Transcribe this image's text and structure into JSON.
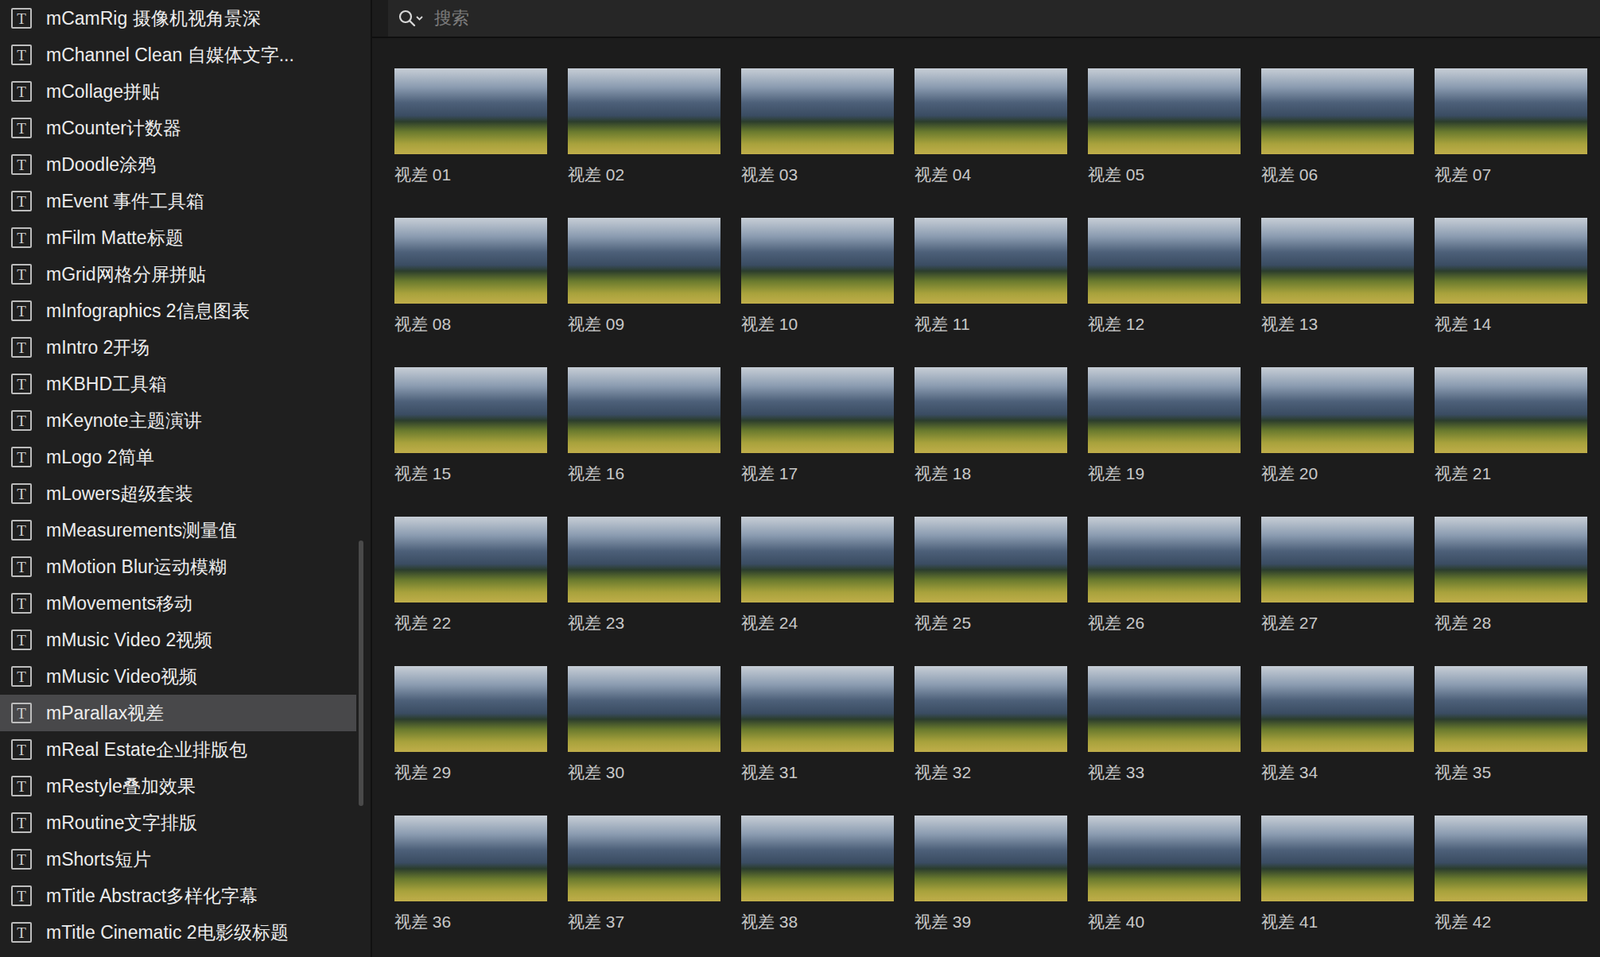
{
  "sidebar": {
    "item_icon": "T",
    "items": [
      {
        "label": "mCamRig 摄像机视角景深",
        "selected": false
      },
      {
        "label": "mChannel Clean 自媒体文字...",
        "selected": false
      },
      {
        "label": "mCollage拼贴",
        "selected": false
      },
      {
        "label": "mCounter计数器",
        "selected": false
      },
      {
        "label": "mDoodle涂鸦",
        "selected": false
      },
      {
        "label": "mEvent 事件工具箱",
        "selected": false
      },
      {
        "label": "mFilm Matte标题",
        "selected": false
      },
      {
        "label": "mGrid网格分屏拼贴",
        "selected": false
      },
      {
        "label": "mInfographics 2信息图表",
        "selected": false
      },
      {
        "label": "mIntro 2开场",
        "selected": false
      },
      {
        "label": "mKBHD工具箱",
        "selected": false
      },
      {
        "label": "mKeynote主题演讲",
        "selected": false
      },
      {
        "label": "mLogo 2简单",
        "selected": false
      },
      {
        "label": "mLowers超级套装",
        "selected": false
      },
      {
        "label": "mMeasurements测量值",
        "selected": false
      },
      {
        "label": "mMotion Blur运动模糊",
        "selected": false
      },
      {
        "label": "mMovements移动",
        "selected": false
      },
      {
        "label": "mMusic Video 2视频",
        "selected": false
      },
      {
        "label": "mMusic Video视频",
        "selected": false
      },
      {
        "label": "mParallax视差",
        "selected": true
      },
      {
        "label": "mReal Estate企业排版包",
        "selected": false
      },
      {
        "label": "mRestyle叠加效果",
        "selected": false
      },
      {
        "label": "mRoutine文字排版",
        "selected": false
      },
      {
        "label": "mShorts短片",
        "selected": false
      },
      {
        "label": "mTitle Abstract多样化字幕",
        "selected": false
      },
      {
        "label": "mTitle Cinematic 2电影级标题",
        "selected": false
      }
    ]
  },
  "scrollbar": {
    "position": 0.565,
    "size": 0.277
  },
  "search": {
    "placeholder": "搜索"
  },
  "thumbnails": [
    {
      "label": "视差 01"
    },
    {
      "label": "视差 02"
    },
    {
      "label": "视差 03"
    },
    {
      "label": "视差 04"
    },
    {
      "label": "视差 05"
    },
    {
      "label": "视差 06"
    },
    {
      "label": "视差 07"
    },
    {
      "label": "视差 08"
    },
    {
      "label": "视差 09"
    },
    {
      "label": "视差 10"
    },
    {
      "label": "视差 11"
    },
    {
      "label": "视差 12"
    },
    {
      "label": "视差 13"
    },
    {
      "label": "视差 14"
    },
    {
      "label": "视差 15"
    },
    {
      "label": "视差 16"
    },
    {
      "label": "视差 17"
    },
    {
      "label": "视差 18"
    },
    {
      "label": "视差 19"
    },
    {
      "label": "视差 20"
    },
    {
      "label": "视差 21"
    },
    {
      "label": "视差 22"
    },
    {
      "label": "视差 23"
    },
    {
      "label": "视差 24"
    },
    {
      "label": "视差 25"
    },
    {
      "label": "视差 26"
    },
    {
      "label": "视差 27"
    },
    {
      "label": "视差 28"
    },
    {
      "label": "视差 29"
    },
    {
      "label": "视差 30"
    },
    {
      "label": "视差 31"
    },
    {
      "label": "视差 32"
    },
    {
      "label": "视差 33"
    },
    {
      "label": "视差 34"
    },
    {
      "label": "视差 35"
    },
    {
      "label": "视差 36"
    },
    {
      "label": "视差 37"
    },
    {
      "label": "视差 38"
    },
    {
      "label": "视差 39"
    },
    {
      "label": "视差 40"
    },
    {
      "label": "视差 41"
    },
    {
      "label": "视差 42"
    }
  ]
}
